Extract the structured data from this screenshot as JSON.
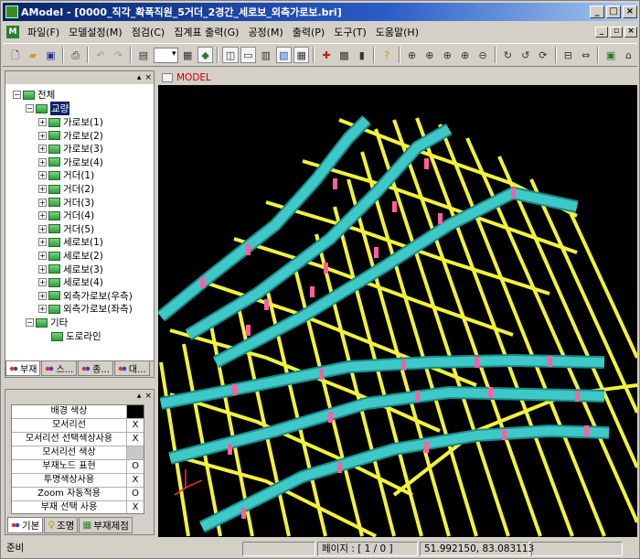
{
  "window": {
    "title": "AModel - [0000_직각_확폭직원_5거더_2경간_세로보_외측가로보.bri]"
  },
  "menu": {
    "items": [
      "파일(F)",
      "모델설정(M)",
      "점검(C)",
      "집계표 출력(G)",
      "공정(M)",
      "출력(P)",
      "도구(T)",
      "도움말(H)"
    ]
  },
  "toolbar": {
    "icons": [
      "new-icon",
      "open-icon",
      "save-icon",
      "print-icon",
      "undo-icon",
      "redo-icon",
      "layer-icon",
      "combo",
      "view-icon",
      "sep",
      "select-icon",
      "window-icon",
      "frame-icon",
      "sep",
      "run-icon",
      "table-icon",
      "grid-icon",
      "sep",
      "help-icon",
      "sep",
      "zoom-icons"
    ]
  },
  "tree": {
    "root": "전체",
    "group": "교량",
    "children": [
      "가로보(1)",
      "가로보(2)",
      "가로보(3)",
      "가로보(4)",
      "거더(1)",
      "거더(2)",
      "거더(3)",
      "거더(4)",
      "거더(5)",
      "세로보(1)",
      "세로보(2)",
      "세로보(3)",
      "세로보(4)",
      "외측가로보(우측)",
      "외측가로보(좌측)"
    ],
    "other": "기타",
    "other_child": "도로라인",
    "tabs": [
      "부재",
      "스...",
      "종...",
      "대..."
    ]
  },
  "properties": {
    "rows": [
      {
        "name": "배경 색상",
        "value": "",
        "kind": "black"
      },
      {
        "name": "모서리선",
        "value": "X"
      },
      {
        "name": "모서리선 선택색상사용",
        "value": "X"
      },
      {
        "name": "모서리선 색상",
        "value": "",
        "kind": "gray"
      },
      {
        "name": "부재노드 표현",
        "value": "O"
      },
      {
        "name": "투명색상사용",
        "value": "X"
      },
      {
        "name": "Zoom 자동적용",
        "value": "O"
      },
      {
        "name": "부재 선택 사용",
        "value": "X"
      }
    ],
    "tabs": [
      "기본",
      "조명",
      "부재제점"
    ]
  },
  "model_view": {
    "tab_label": "MODEL",
    "colors": {
      "background": "#000000",
      "beams": "#f2f23a",
      "girders": "#3ec8c8",
      "joints": "#ff5fa0"
    }
  },
  "status": {
    "left": "준비",
    "page": "페이지 : [ 1 / 0 ]",
    "coords": "51.992150,     83.083113"
  }
}
